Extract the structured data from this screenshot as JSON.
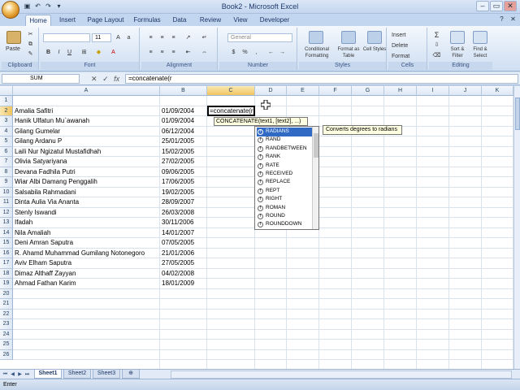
{
  "window": {
    "title": "Book2 - Microsoft Excel"
  },
  "tabs": [
    "Home",
    "Insert",
    "Page Layout",
    "Formulas",
    "Data",
    "Review",
    "View",
    "Developer"
  ],
  "ribbon": {
    "groups": {
      "clipboard": "Clipboard",
      "font": "Font",
      "alignment": "Alignment",
      "number": "Number",
      "styles": "Styles",
      "cells": "Cells",
      "editing": "Editing"
    },
    "paste": "Paste",
    "font_size": "11",
    "number_format": "General",
    "conditional_formatting": "Conditional Formatting",
    "format_as_table": "Format as Table",
    "cell_styles": "Cell Styles",
    "insert": "Insert",
    "delete": "Delete",
    "format": "Format",
    "sort_filter": "Sort & Filter",
    "find_select": "Find & Select"
  },
  "formula_bar": {
    "name_box": "SUM",
    "formula": "=concatenate(r",
    "fx": "fx"
  },
  "columns": [
    "A",
    "B",
    "C",
    "D",
    "E",
    "F",
    "G",
    "H",
    "I",
    "J",
    "K"
  ],
  "rows": [
    {
      "n": "1",
      "a": "",
      "b": ""
    },
    {
      "n": "2",
      "a": "Amalia Safitri",
      "b": "01/09/2004"
    },
    {
      "n": "3",
      "a": "Hanik Ulfatun Mu`awanah",
      "b": "01/09/2004"
    },
    {
      "n": "4",
      "a": "Gilang Gumelar",
      "b": "06/12/2004"
    },
    {
      "n": "5",
      "a": "Gilang Ardanu P",
      "b": "25/01/2005"
    },
    {
      "n": "6",
      "a": "Laili Nur Ngizatul Mustafidhah",
      "b": "15/02/2005"
    },
    {
      "n": "7",
      "a": "Olivia Satyariyana",
      "b": "27/02/2005"
    },
    {
      "n": "8",
      "a": "Devana Fadhila Putri",
      "b": "09/06/2005"
    },
    {
      "n": "9",
      "a": "Wiar Albi Damang Penggalih",
      "b": "17/06/2005"
    },
    {
      "n": "10",
      "a": "Salsabila Rahmadani",
      "b": "19/02/2005"
    },
    {
      "n": "11",
      "a": "Dinta Aulia Via Ananta",
      "b": "28/09/2007"
    },
    {
      "n": "12",
      "a": "Stenly Iswandi",
      "b": "26/03/2008"
    },
    {
      "n": "13",
      "a": "Ifadah",
      "b": "30/11/2006"
    },
    {
      "n": "14",
      "a": "Nila Amaliah",
      "b": "14/01/2007"
    },
    {
      "n": "15",
      "a": "Deni Amran Saputra",
      "b": "07/05/2005"
    },
    {
      "n": "16",
      "a": "R. Ahamd Muhammad Gumilang Notonegoro",
      "b": "21/01/2006"
    },
    {
      "n": "17",
      "a": "Aviv Elham Saputra",
      "b": "27/05/2005"
    },
    {
      "n": "18",
      "a": "Dimaz Althaff Zayyan",
      "b": "04/02/2008"
    },
    {
      "n": "19",
      "a": "Ahmad Fathan Karim",
      "b": "18/01/2009"
    },
    {
      "n": "20",
      "a": "",
      "b": ""
    },
    {
      "n": "21",
      "a": "",
      "b": ""
    },
    {
      "n": "22",
      "a": "",
      "b": ""
    },
    {
      "n": "23",
      "a": "",
      "b": ""
    },
    {
      "n": "24",
      "a": "",
      "b": ""
    },
    {
      "n": "25",
      "a": "",
      "b": ""
    },
    {
      "n": "26",
      "a": "",
      "b": ""
    }
  ],
  "active_cell_text": "=concatenate(r",
  "arg_tooltip": "CONCATENATE(text1, [text2], ...)",
  "autocomplete": [
    "RADIANS",
    "RAND",
    "RANDBETWEEN",
    "RANK",
    "RATE",
    "RECEIVED",
    "REPLACE",
    "REPT",
    "RIGHT",
    "ROMAN",
    "ROUND",
    "ROUNDDOWN"
  ],
  "autocomplete_description": "Converts degrees to radians",
  "sheets": [
    "Sheet1",
    "Sheet2",
    "Sheet3"
  ],
  "status": "Enter"
}
